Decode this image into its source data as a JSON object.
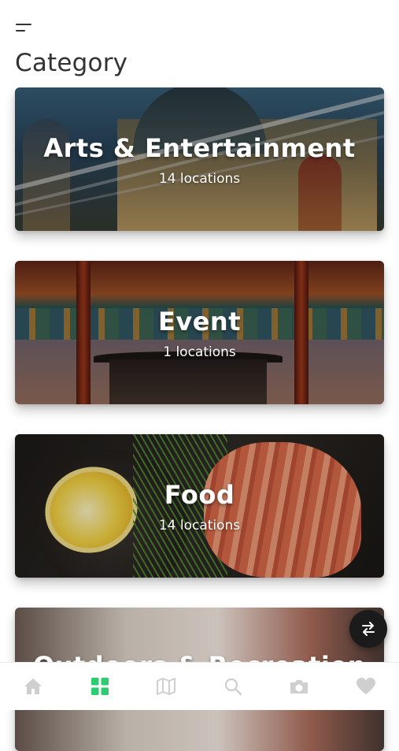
{
  "header": {
    "menu_icon": "menu-icon",
    "title": "Category"
  },
  "categories": [
    {
      "name": "Arts & Entertainment",
      "count": "14 locations"
    },
    {
      "name": "Event",
      "count": "1 locations"
    },
    {
      "name": "Food",
      "count": "14 locations"
    },
    {
      "name": "Outdoors & Recreation",
      "count": ""
    }
  ],
  "fab": {
    "icon": "swap-arrows-icon"
  },
  "tabbar": {
    "active_color": "#2ecc71",
    "inactive_color": "#cfcfcf",
    "tabs": [
      {
        "icon": "home-icon",
        "active": false
      },
      {
        "icon": "grid-icon",
        "active": true
      },
      {
        "icon": "map-icon",
        "active": false
      },
      {
        "icon": "search-icon",
        "active": false
      },
      {
        "icon": "camera-icon",
        "active": false
      },
      {
        "icon": "heart-icon",
        "active": false
      }
    ]
  }
}
